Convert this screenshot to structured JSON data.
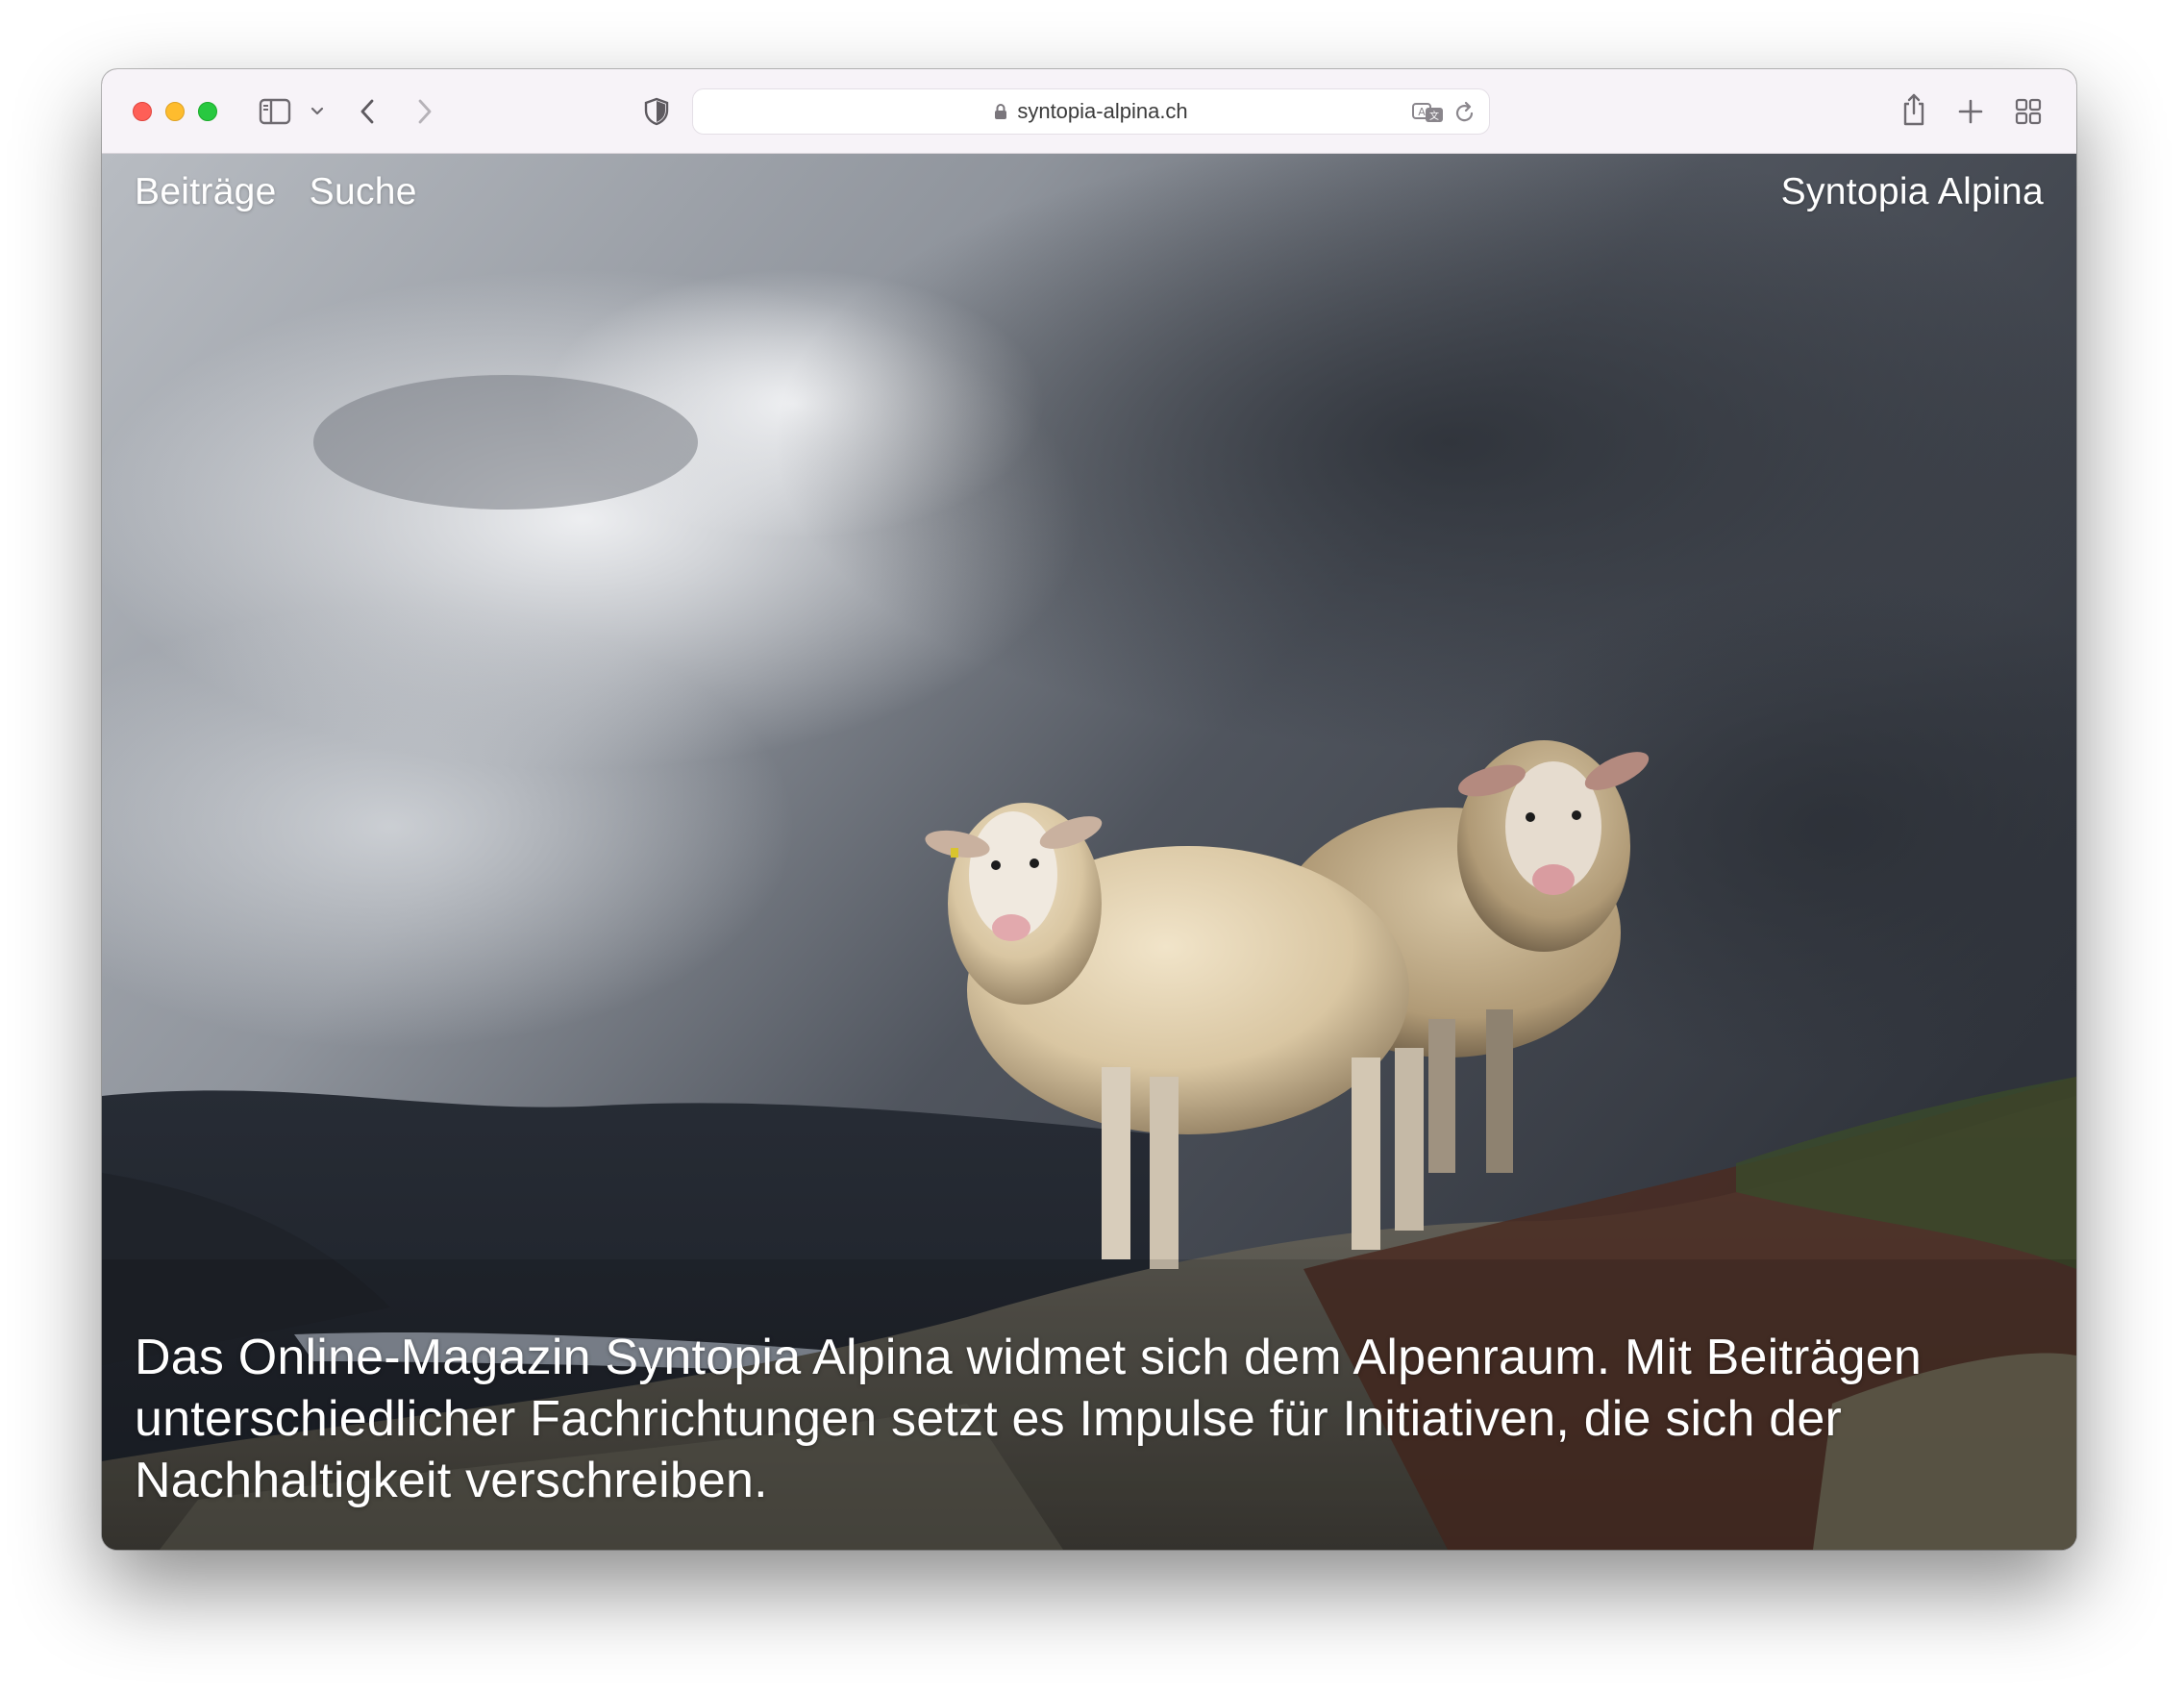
{
  "browser": {
    "url": "syntopia-alpina.ch",
    "colors": {
      "toolbar": "#f7f3f8",
      "close": "#fe5f57",
      "minimize": "#febc2e",
      "zoom": "#28c840"
    },
    "icons": [
      "sidebar-icon",
      "chevron-down-icon",
      "back-icon",
      "forward-icon",
      "shield-icon",
      "lock-icon",
      "translate-icon",
      "reload-icon",
      "share-icon",
      "new-tab-icon",
      "tab-overview-icon"
    ]
  },
  "site": {
    "nav": {
      "posts": "Beiträge",
      "search": "Suche"
    },
    "brand": "Syntopia Alpina",
    "intro": "Das Online-Magazin Syntopia Alpina widmet sich dem Alpenraum. Mit Beiträgen unterschiedlicher Fachrichtungen setzt es Impulse für Initiativen, die sich der Nachhaltigkeit verschreiben."
  }
}
